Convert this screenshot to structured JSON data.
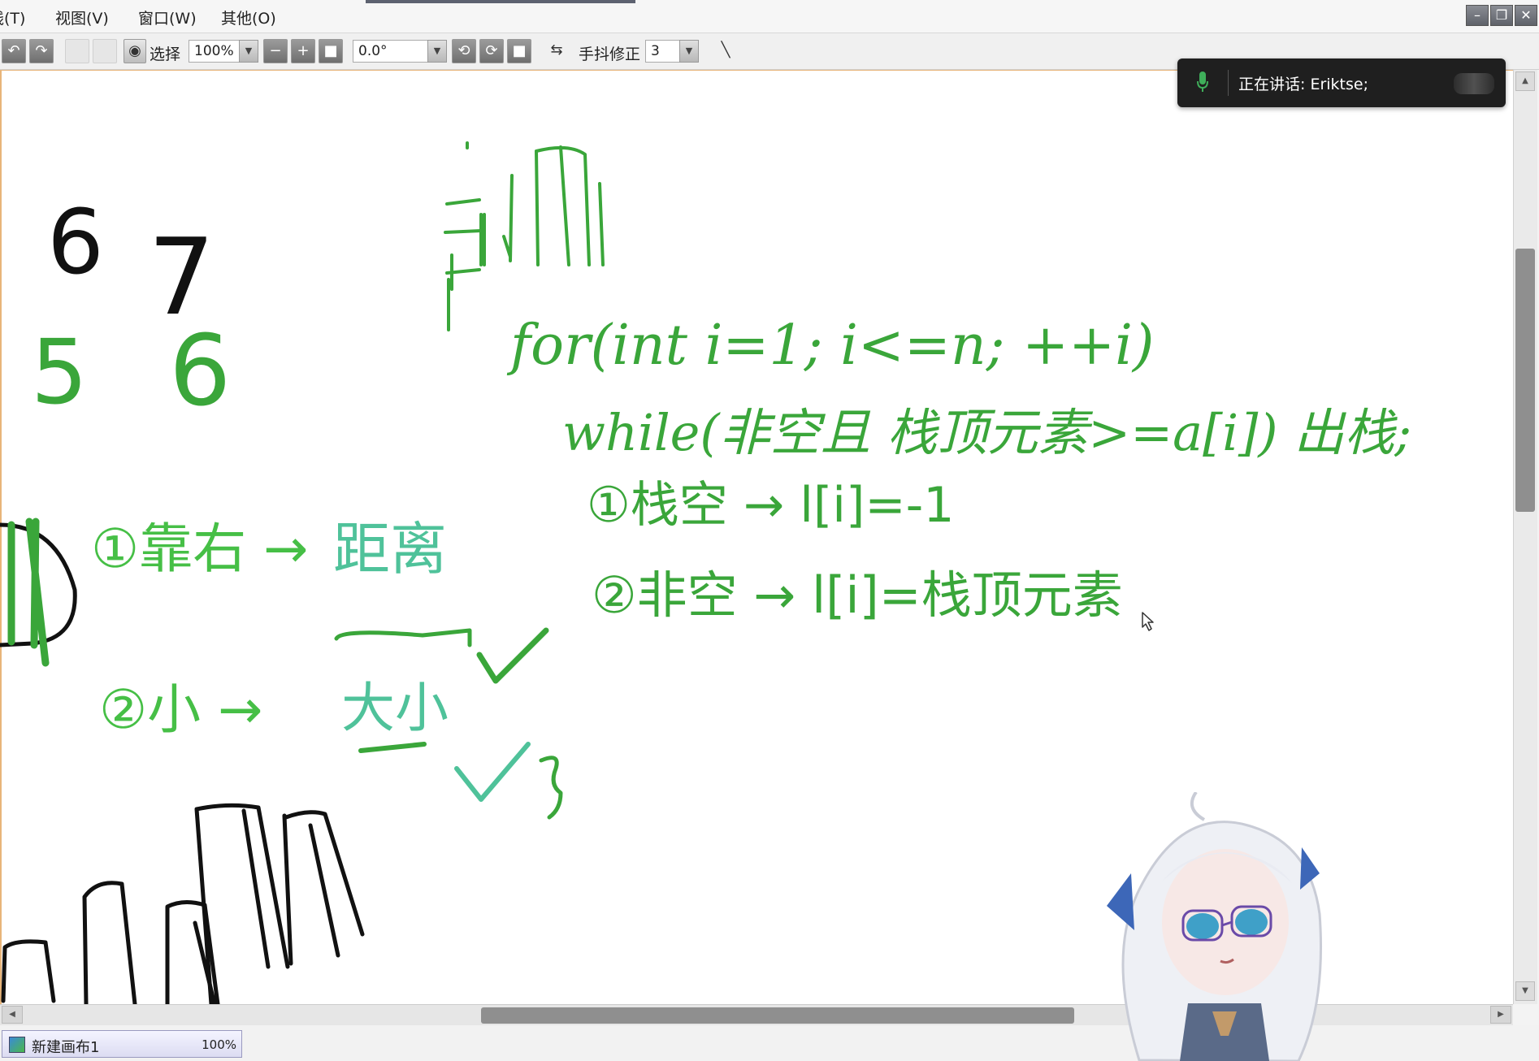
{
  "menu": {
    "items": [
      "线(T)",
      "视图(V)",
      "窗口(W)",
      "其他(O)"
    ]
  },
  "window_controls": {
    "minimize": "–",
    "restore": "❐",
    "close": "✕"
  },
  "toolbar": {
    "undo_icon": "undo-icon",
    "redo_icon": "redo-icon",
    "select_label": "选择",
    "zoom_value": "100%",
    "rotation_value": "0.0°",
    "stabilizer_label": "手抖修正",
    "stabilizer_value": "3"
  },
  "voice_overlay": {
    "text": "正在讲话:  Eriktse;",
    "mic_color": "#3fae5a"
  },
  "canvas_tab": {
    "name": "新建画布1",
    "zoom": "100%"
  },
  "drawing": {
    "numbers": {
      "a": "6",
      "b": "7",
      "c": "5",
      "d": "6"
    },
    "code_line1": "for(int i=1; i<=n; ++i)",
    "code_line2": "while(非空且 栈顶元素>=a[i]) 出栈;",
    "case1": "①栈空 → l[i]=-1",
    "case2": "②非空 → l[i]=栈顶元素",
    "rule1_a": "①靠右 → ",
    "rule1_b": "距离",
    "rule2_a": "②小 → ",
    "rule2_b": "大小",
    "colors": {
      "ink_black": "#111111",
      "ink_green": "#3aa63a",
      "ink_teal": "#4fc29a"
    }
  }
}
